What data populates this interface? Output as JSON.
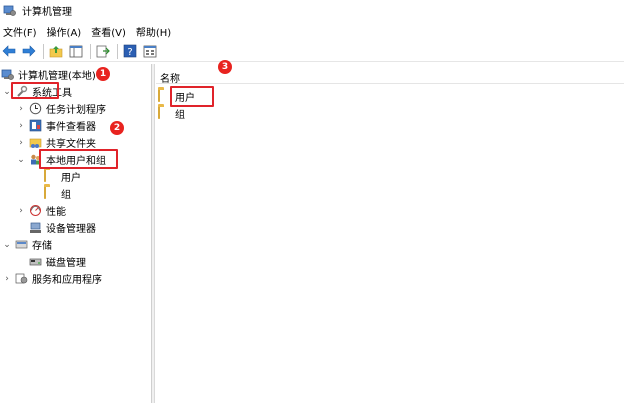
{
  "window": {
    "title": "计算机管理"
  },
  "menu": {
    "items": [
      "文件(F)",
      "操作(A)",
      "查看(V)",
      "帮助(H)"
    ]
  },
  "toolbar": {
    "buttons": [
      "back-arrow-icon",
      "forward-arrow-icon",
      "up-folder-icon",
      "show-hide-tree-icon",
      "export-list-icon",
      "help-icon",
      "properties-icon"
    ]
  },
  "tree": {
    "root": "计算机管理(本地)",
    "system_tools": "系统工具",
    "task_scheduler": "任务计划程序",
    "event_viewer": "事件查看器",
    "shared_folders": "共享文件夹",
    "local_users_groups": "本地用户和组",
    "users": "用户",
    "groups": "组",
    "performance": "性能",
    "device_manager": "设备管理器",
    "storage": "存储",
    "disk_management": "磁盘管理",
    "services_apps": "服务和应用程序"
  },
  "list": {
    "column_name": "名称",
    "items": [
      "用户",
      "组"
    ]
  },
  "annotations": {
    "badge1": "1",
    "badge2": "2",
    "badge3": "3",
    "color": "#e0232a"
  }
}
